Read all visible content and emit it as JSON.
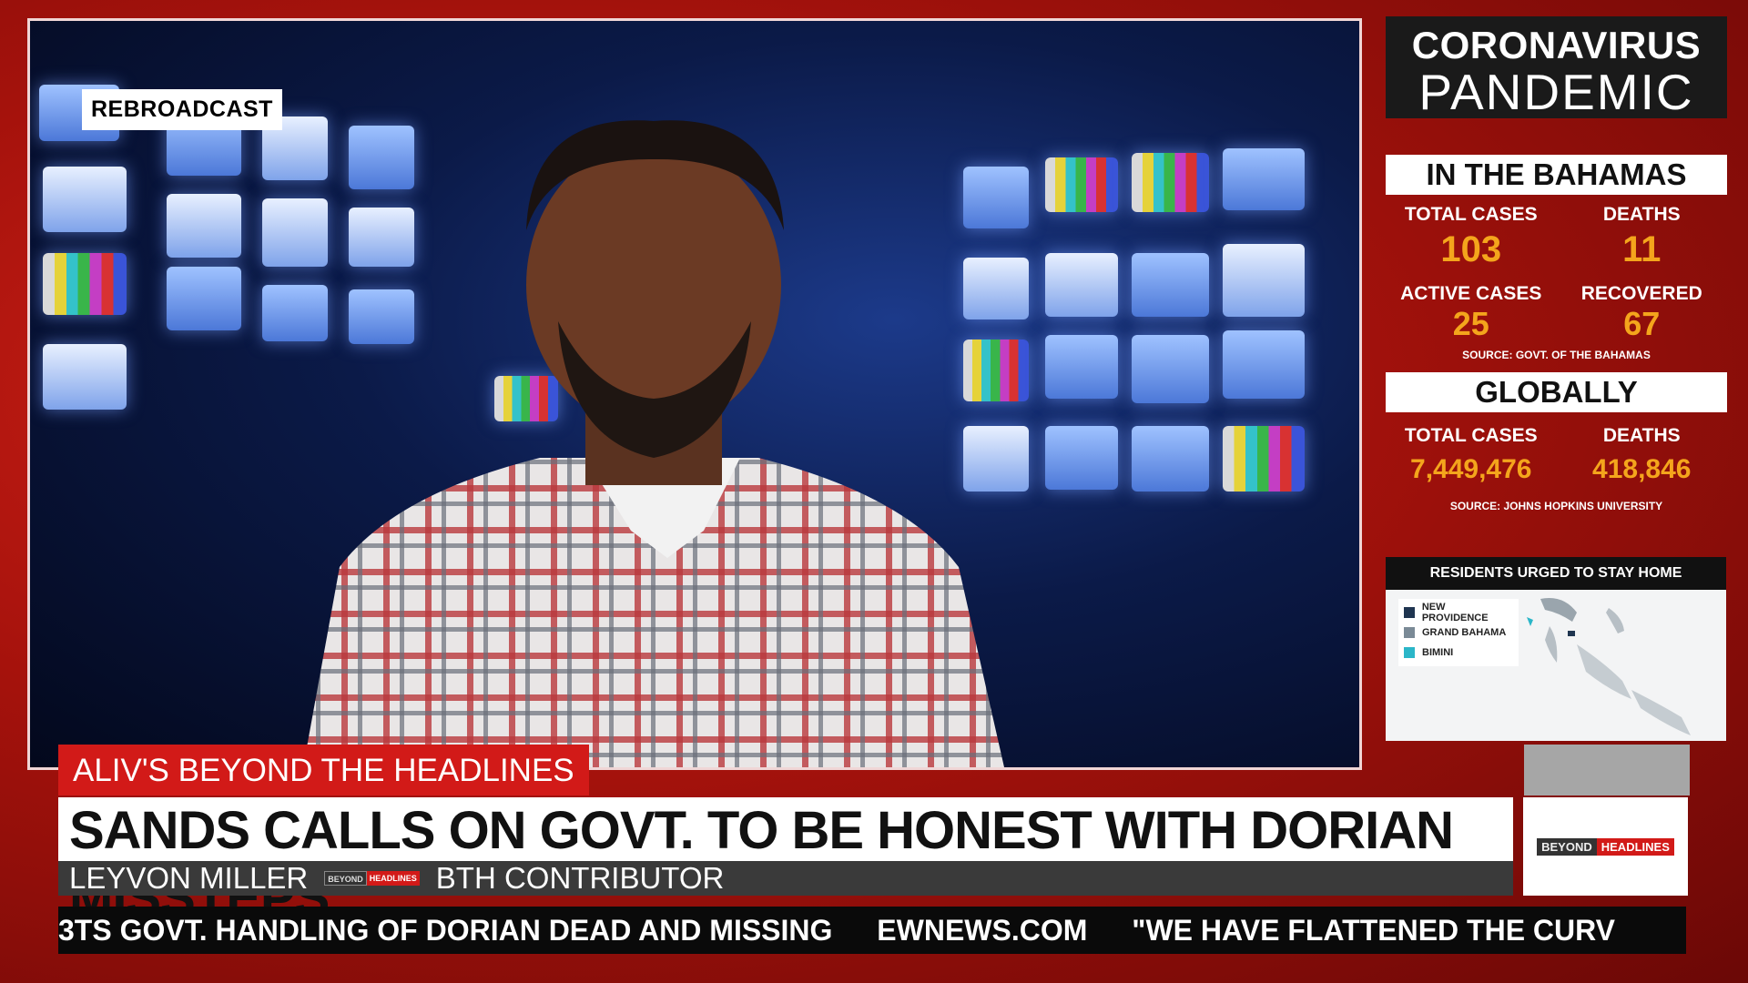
{
  "video": {
    "badge": "REBROADCAST"
  },
  "panel": {
    "title_line1": "CORONAVIRUS",
    "title_line2": "PANDEMIC",
    "bahamas": {
      "heading": "IN THE BAHAMAS",
      "total_cases_label": "TOTAL CASES",
      "total_cases": "103",
      "deaths_label": "DEATHS",
      "deaths": "11",
      "active_label": "ACTIVE CASES",
      "active": "25",
      "recovered_label": "RECOVERED",
      "recovered": "67",
      "source": "SOURCE: GOVT. OF THE BAHAMAS"
    },
    "global": {
      "heading": "GLOBALLY",
      "total_cases_label": "TOTAL CASES",
      "total_cases": "7,449,476",
      "deaths_label": "DEATHS",
      "deaths": "418,846",
      "source": "SOURCE: JOHNS HOPKINS UNIVERSITY"
    },
    "map": {
      "heading": "RESIDENTS URGED TO STAY HOME",
      "legend": [
        {
          "label": "NEW PROVIDENCE",
          "color": "#1f3550"
        },
        {
          "label": "GRAND BAHAMA",
          "color": "#7a8a96"
        },
        {
          "label": "BIMINI",
          "color": "#2bb6c8"
        }
      ]
    }
  },
  "lower_third": {
    "show": "ALIV'S BEYOND THE HEADLINES",
    "headline": "SANDS CALLS ON GOVT. TO BE HONEST WITH DORIAN MISSTEPS",
    "name": "LEYVON MILLER",
    "role": "BTH CONTRIBUTOR",
    "logo_left": "BEYOND",
    "logo_right": "HEADLINES"
  },
  "ticker": [
    "3TS GOVT. HANDLING OF DORIAN DEAD AND MISSING",
    "EWNEWS.COM",
    "\"WE HAVE FLATTENED THE CURV"
  ],
  "colors": {
    "accent_red": "#d21a18",
    "stat_orange": "#f4a51c"
  }
}
